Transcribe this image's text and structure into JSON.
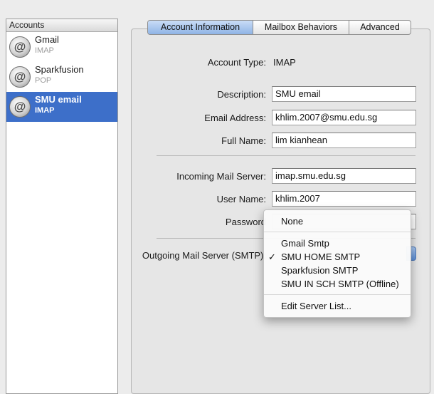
{
  "sidebar": {
    "header": "Accounts",
    "accounts": [
      {
        "name": "Gmail",
        "type": "IMAP",
        "selected": false
      },
      {
        "name": "Sparkfusion",
        "type": "POP",
        "selected": false
      },
      {
        "name": "SMU email",
        "type": "IMAP",
        "selected": true
      }
    ],
    "avatar_glyph": "@"
  },
  "tabs": {
    "items": [
      "Account Information",
      "Mailbox Behaviors",
      "Advanced"
    ],
    "active": "Account Information"
  },
  "form": {
    "account_type_label": "Account Type:",
    "account_type_value": "IMAP",
    "description_label": "Description:",
    "description_value": "SMU email",
    "email_label": "Email Address:",
    "email_value": "khlim.2007@smu.edu.sg",
    "fullname_label": "Full Name:",
    "fullname_value": "lim kianhean",
    "incoming_label": "Incoming Mail Server:",
    "incoming_value": "imap.smu.edu.sg",
    "username_label": "User Name:",
    "username_value": "khlim.2007",
    "password_label": "Password",
    "outgoing_label": "Outgoing Mail Server (SMTP):"
  },
  "smtp_menu": {
    "none": "None",
    "servers": [
      {
        "label": "Gmail Smtp",
        "checked": false
      },
      {
        "label": "SMU HOME SMTP",
        "checked": true
      },
      {
        "label": "Sparkfusion SMTP",
        "checked": false
      },
      {
        "label": "SMU IN SCH SMTP (Offline)",
        "checked": false
      }
    ],
    "edit": "Edit Server List...",
    "check_glyph": "✓"
  },
  "colors": {
    "selection": "#3d6fc9",
    "active_tab": "#a9c7f0"
  }
}
